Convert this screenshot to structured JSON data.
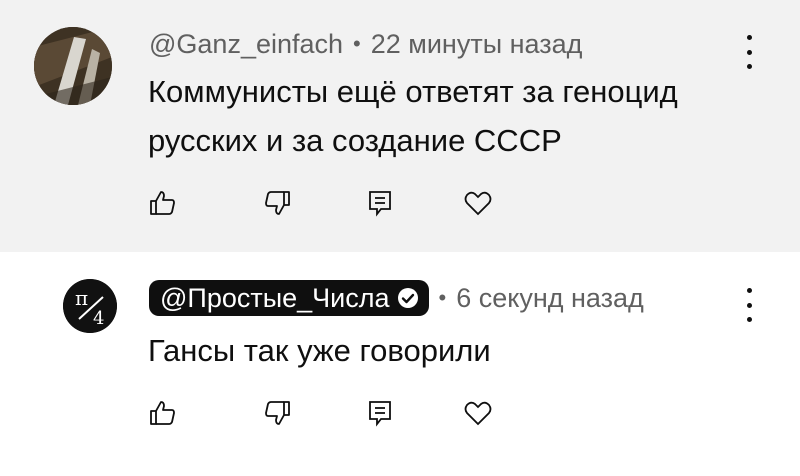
{
  "comments": [
    {
      "author": "@Ganz_einfach",
      "time": "22 минуты назад",
      "text": "Коммунисты ещё ответят за геноцид русских и за создание СССР",
      "icons": [
        "like-icon",
        "dislike-icon",
        "reply-icon",
        "heart-icon",
        "more-vertical-icon"
      ]
    },
    {
      "author": "@Простые_Числа",
      "verified": true,
      "time": "6 секунд назад",
      "text": "Гансы так уже говорили",
      "icons": [
        "like-icon",
        "dislike-icon",
        "reply-icon",
        "heart-icon",
        "more-vertical-icon"
      ]
    }
  ],
  "colors": {
    "highlight_bg": "#f2f2f2",
    "author_chip_bg": "#0f0f0f",
    "meta_text": "#606060",
    "body_text": "#0f0f0f"
  }
}
